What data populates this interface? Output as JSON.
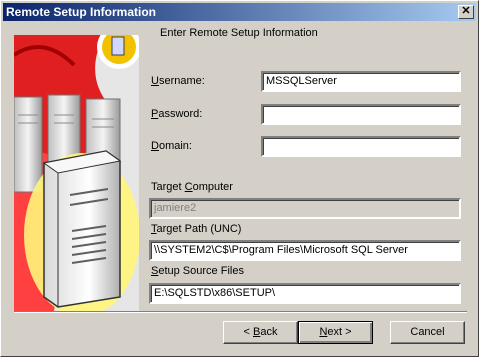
{
  "window": {
    "title": "Remote Setup Information"
  },
  "header": {
    "text": "Enter Remote Setup Information"
  },
  "form": {
    "username": {
      "label_u": "U",
      "label_rest": "sername:",
      "value": "MSSQLServer"
    },
    "password": {
      "label_u": "P",
      "label_rest": "assword:",
      "value": ""
    },
    "domain": {
      "label_u": "D",
      "label_rest": "omain:",
      "value": ""
    },
    "target_computer": {
      "label_pre": "Target ",
      "label_u": "C",
      "label_rest": "omputer",
      "value": "jamiere2"
    },
    "target_path": {
      "label_u": "T",
      "label_rest": "arget Path (UNC)",
      "value": "\\\\SYSTEM2\\C$\\Program Files\\Microsoft SQL Server"
    },
    "setup_source": {
      "label_u": "S",
      "label_rest": "etup Source Files",
      "value": "E:\\SQLSTD\\x86\\SETUP\\"
    }
  },
  "buttons": {
    "back_prefix": "< ",
    "back_u": "B",
    "back_rest": "ack",
    "next_u": "N",
    "next_rest": "ext >",
    "cancel": "Cancel"
  },
  "icons": {
    "close": "close-icon",
    "art": "server-illustration"
  }
}
